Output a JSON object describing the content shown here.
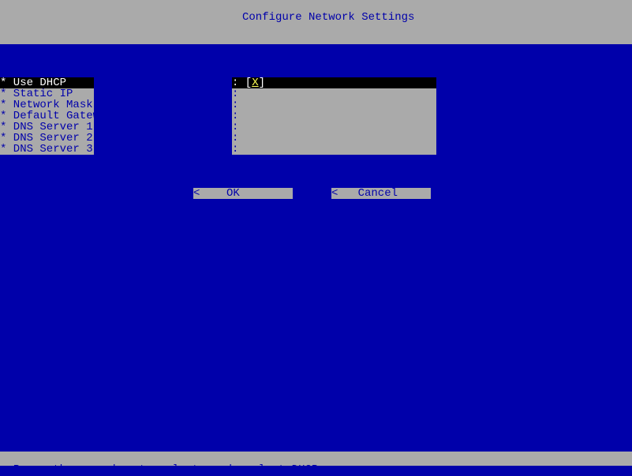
{
  "header": {
    "title": "Configure Network Settings"
  },
  "fields": [
    {
      "label": "* Use DHCP",
      "value": ": [X]",
      "selected": true
    },
    {
      "label": "* Static IP",
      "value": ":",
      "selected": false
    },
    {
      "label": "* Network Mask",
      "value": ":",
      "selected": false
    },
    {
      "label": "* Default Gateway",
      "value": ":",
      "selected": false
    },
    {
      "label": "* DNS Server 1",
      "value": ":",
      "selected": false
    },
    {
      "label": "* DNS Server 2",
      "value": ":",
      "selected": false
    },
    {
      "label": "* DNS Server 3",
      "value": ":",
      "selected": false
    }
  ],
  "buttons": {
    "ok": "<    OK         >",
    "cancel": "<   Cancel       >"
  },
  "footer": {
    "hint": "Press the spacebar to select or de-select DHCP"
  }
}
